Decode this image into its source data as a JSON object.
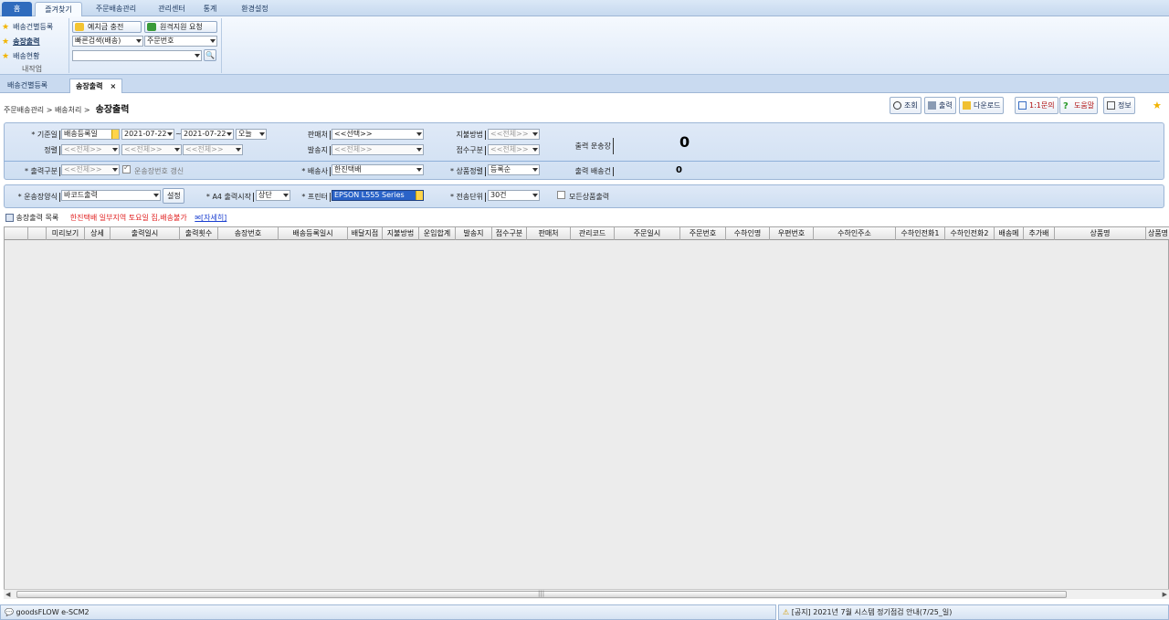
{
  "ribbon_tabs": [
    "홈",
    "즐겨찾기",
    "주문배송관리",
    "관리센터",
    "통계",
    "환경설정"
  ],
  "favorites": [
    "배송건별등록",
    "송장출력",
    "배송현황"
  ],
  "favorites_group": "내작업",
  "ribbon_buttons": {
    "deposit": "예치금 충전",
    "remote": "원격지원 요청"
  },
  "quick_search": {
    "type": "빠른검색(배송)",
    "field": "주문번호",
    "value": ""
  },
  "doc_tabs": [
    "배송건별등록",
    "송장출력"
  ],
  "close_glyph": "×",
  "breadcrumb": {
    "path": "주문배송관리 > 배송처리 >",
    "title": "송장출력"
  },
  "toolbar": [
    "조회",
    "출력",
    "다운로드",
    "1:1문의",
    "도움말",
    "정보"
  ],
  "filter": {
    "base_date_label": "* 기준일",
    "base_date_type": "배송등록일",
    "date_from": "2021-07-22",
    "tilde": "~",
    "date_to": "2021-07-22",
    "period": "오늘",
    "sort_label": "정렬",
    "sort1": "<<전체>>",
    "sort2": "<<전체>>",
    "sort3": "<<전체>>",
    "seller_label": "판매처",
    "seller": "<<선택>>",
    "origin_label": "발송지",
    "origin": "<<전체>>",
    "payment_label": "지불방법",
    "payment": "<<전체>>",
    "receipt_label": "접수구분",
    "receipt": "<<전체>>",
    "print_waybill_label": "출력 운송장",
    "print_waybill_count": "0",
    "print_type_label": "* 출력구분",
    "print_type": "<<전체>>",
    "update_waybill_label": "운송장번호 갱신",
    "carrier_label": "* 배송사",
    "carrier": "한진택배",
    "product_sort_label": "* 상품정렬",
    "product_sort": "등록순",
    "print_delivery_label": "출력 배송건",
    "print_delivery_count": "0"
  },
  "print_settings": {
    "method_label": "* 운송장양식",
    "method": "바코드출력",
    "settings_button": "설정",
    "a4_label": "* A4 출력시작",
    "a4": "상단",
    "printer_label": "* 프린터",
    "printer": "EPSON L555 Series",
    "unit_label": "* 전송단위",
    "unit": "30건",
    "all_products_label": "모든상품출력"
  },
  "list": {
    "title": "송장출력 목록",
    "notice": "한진택배 일부지역 토요일 집,배송불가",
    "detail_link": "[자세히]",
    "columns": [
      "",
      "",
      "미리보기",
      "상세",
      "출력일시",
      "출력횟수",
      "송장번호",
      "배송등록일시",
      "배달지점",
      "지불방법",
      "운임합계",
      "발송지",
      "접수구분",
      "판매처",
      "관리코드",
      "주문일시",
      "주문번호",
      "수하인명",
      "우편번호",
      "수하인주소",
      "수하인전화1",
      "수하인전화2",
      "배송메",
      "추가배",
      "상품명",
      "상품명"
    ]
  },
  "scroll_grip": "|||",
  "statusbar": {
    "left": "goodsFLOW e-SCM2",
    "right": "[공지] 2021년 7월 시스템 정기점검 안내(7/25_일)"
  },
  "colors": {
    "accent": "#2f6bbd",
    "panel": "#d6e4f5",
    "notice": "#e02020",
    "link": "#1a3fd0"
  }
}
